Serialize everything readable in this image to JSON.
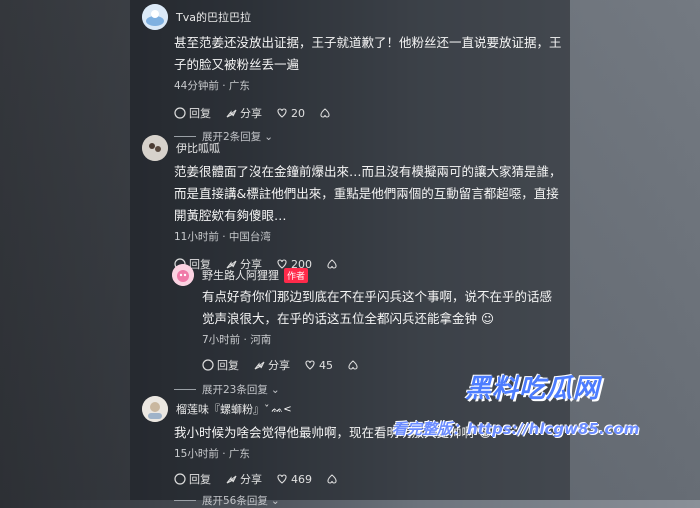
{
  "comments": [
    {
      "user": "Tva的巴拉巴拉",
      "text": "甚至范姜还没放出证据，王子就道歉了！他粉丝还一直说要放证据，王子的脸又被粉丝丢一遍",
      "meta": "44分钟前 · 广东",
      "reply_label": "回复",
      "share_label": "分享",
      "likes": "20",
      "expand": "展开2条回复"
    },
    {
      "user": "伊比呱呱",
      "text": "范姜很體面了沒在金鐘前爆出來…而且沒有模擬兩可的讓大家猜是誰，而是直接講&標註他們出來，重點是他們兩個的互動留言都超噁，直接開黃腔欸有夠傻眼…",
      "meta": "11小时前 · 中国台湾",
      "reply_label": "回复",
      "share_label": "分享",
      "likes": "200"
    },
    {
      "user": "野生路人阿狸狸",
      "badge": "作者",
      "text": "有点好奇你们那边到底在不在乎闪兵这个事啊，说不在乎的话感觉声浪很大，在乎的话这五位全都闪兵还能拿金钟",
      "meta": "7小时前 · 河南",
      "reply_label": "回复",
      "share_label": "分享",
      "likes": "45",
      "expand": "展开23条回复"
    },
    {
      "user": "榴莲味『螺螄粉』ˇ",
      "text": "我小时候为啥会觉得他最帅啊，现在看明明敖犬更帅啊",
      "meta": "15小时前 · 广东",
      "reply_label": "回复",
      "share_label": "分享",
      "likes": "469",
      "expand": "展开56条回复"
    }
  ],
  "watermark": {
    "line1": "黑料吃瓜网",
    "line2": "看完整版：https://hlcgw85.com"
  }
}
